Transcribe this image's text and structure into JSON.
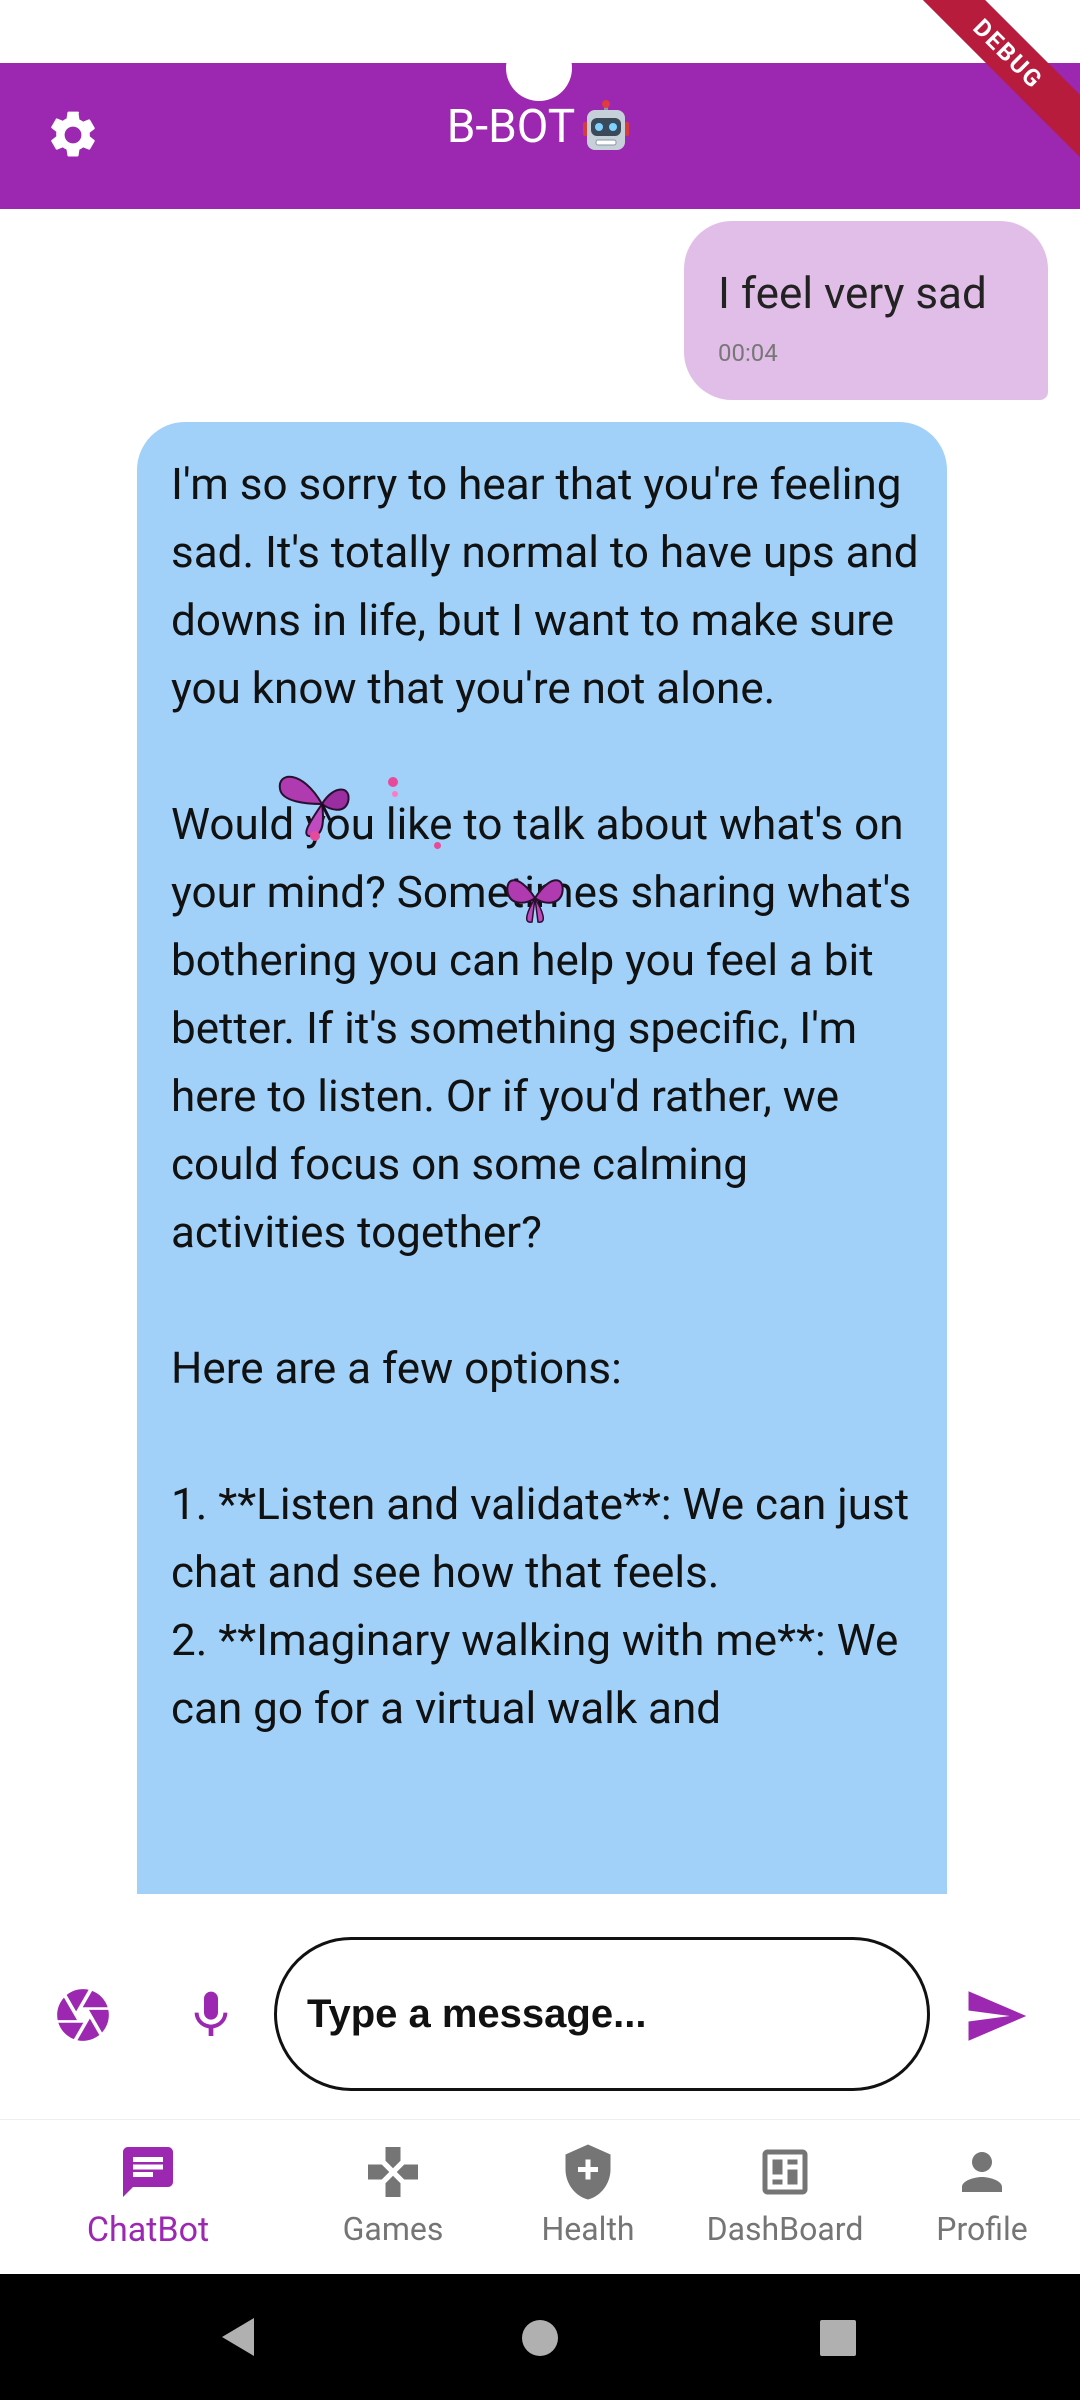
{
  "colors": {
    "primary": "#9c27b0",
    "user_bubble": "#e1bee7",
    "bot_bubble": "#a1d0f8",
    "debug": "#b71c3c"
  },
  "app_bar": {
    "title": "B-BOT",
    "title_emoji_icon": "robot-face-icon",
    "settings_icon": "gear-icon"
  },
  "debug_banner": "DEBUG",
  "messages": [
    {
      "sender": "user",
      "text": "I feel very sad",
      "time": "00:04"
    },
    {
      "sender": "bot",
      "text": "I'm so sorry to hear that you're feeling sad. It's totally normal to have ups and downs in life, but I want to make sure you know that you're not alone.\n\nWould you like to talk about what's on your mind? Sometimes sharing what's bothering you can help you feel a bit better. If it's something specific, I'm here to listen. Or if you'd rather, we could focus on some calming activities together?\n\nHere are a few options:\n\n1. **Listen and validate**: We can just chat and see how that feels.\n2. **Imaginary walking with me**: We can go for a virtual walk and"
    }
  ],
  "composer": {
    "placeholder": "Type a message...",
    "camera_icon": "camera-shutter-icon",
    "mic_icon": "microphone-icon",
    "send_icon": "send-icon"
  },
  "bottom_nav": {
    "items": [
      {
        "label": "ChatBot",
        "icon": "chat-icon",
        "active": true
      },
      {
        "label": "Games",
        "icon": "gamepad-icon",
        "active": false
      },
      {
        "label": "Health",
        "icon": "health-shield-icon",
        "active": false
      },
      {
        "label": "DashBoard",
        "icon": "dashboard-icon",
        "active": false
      },
      {
        "label": "Profile",
        "icon": "person-icon",
        "active": false
      }
    ]
  },
  "system_nav": {
    "back_icon": "back-triangle-icon",
    "home_icon": "home-circle-icon",
    "recents_icon": "recents-square-icon"
  }
}
